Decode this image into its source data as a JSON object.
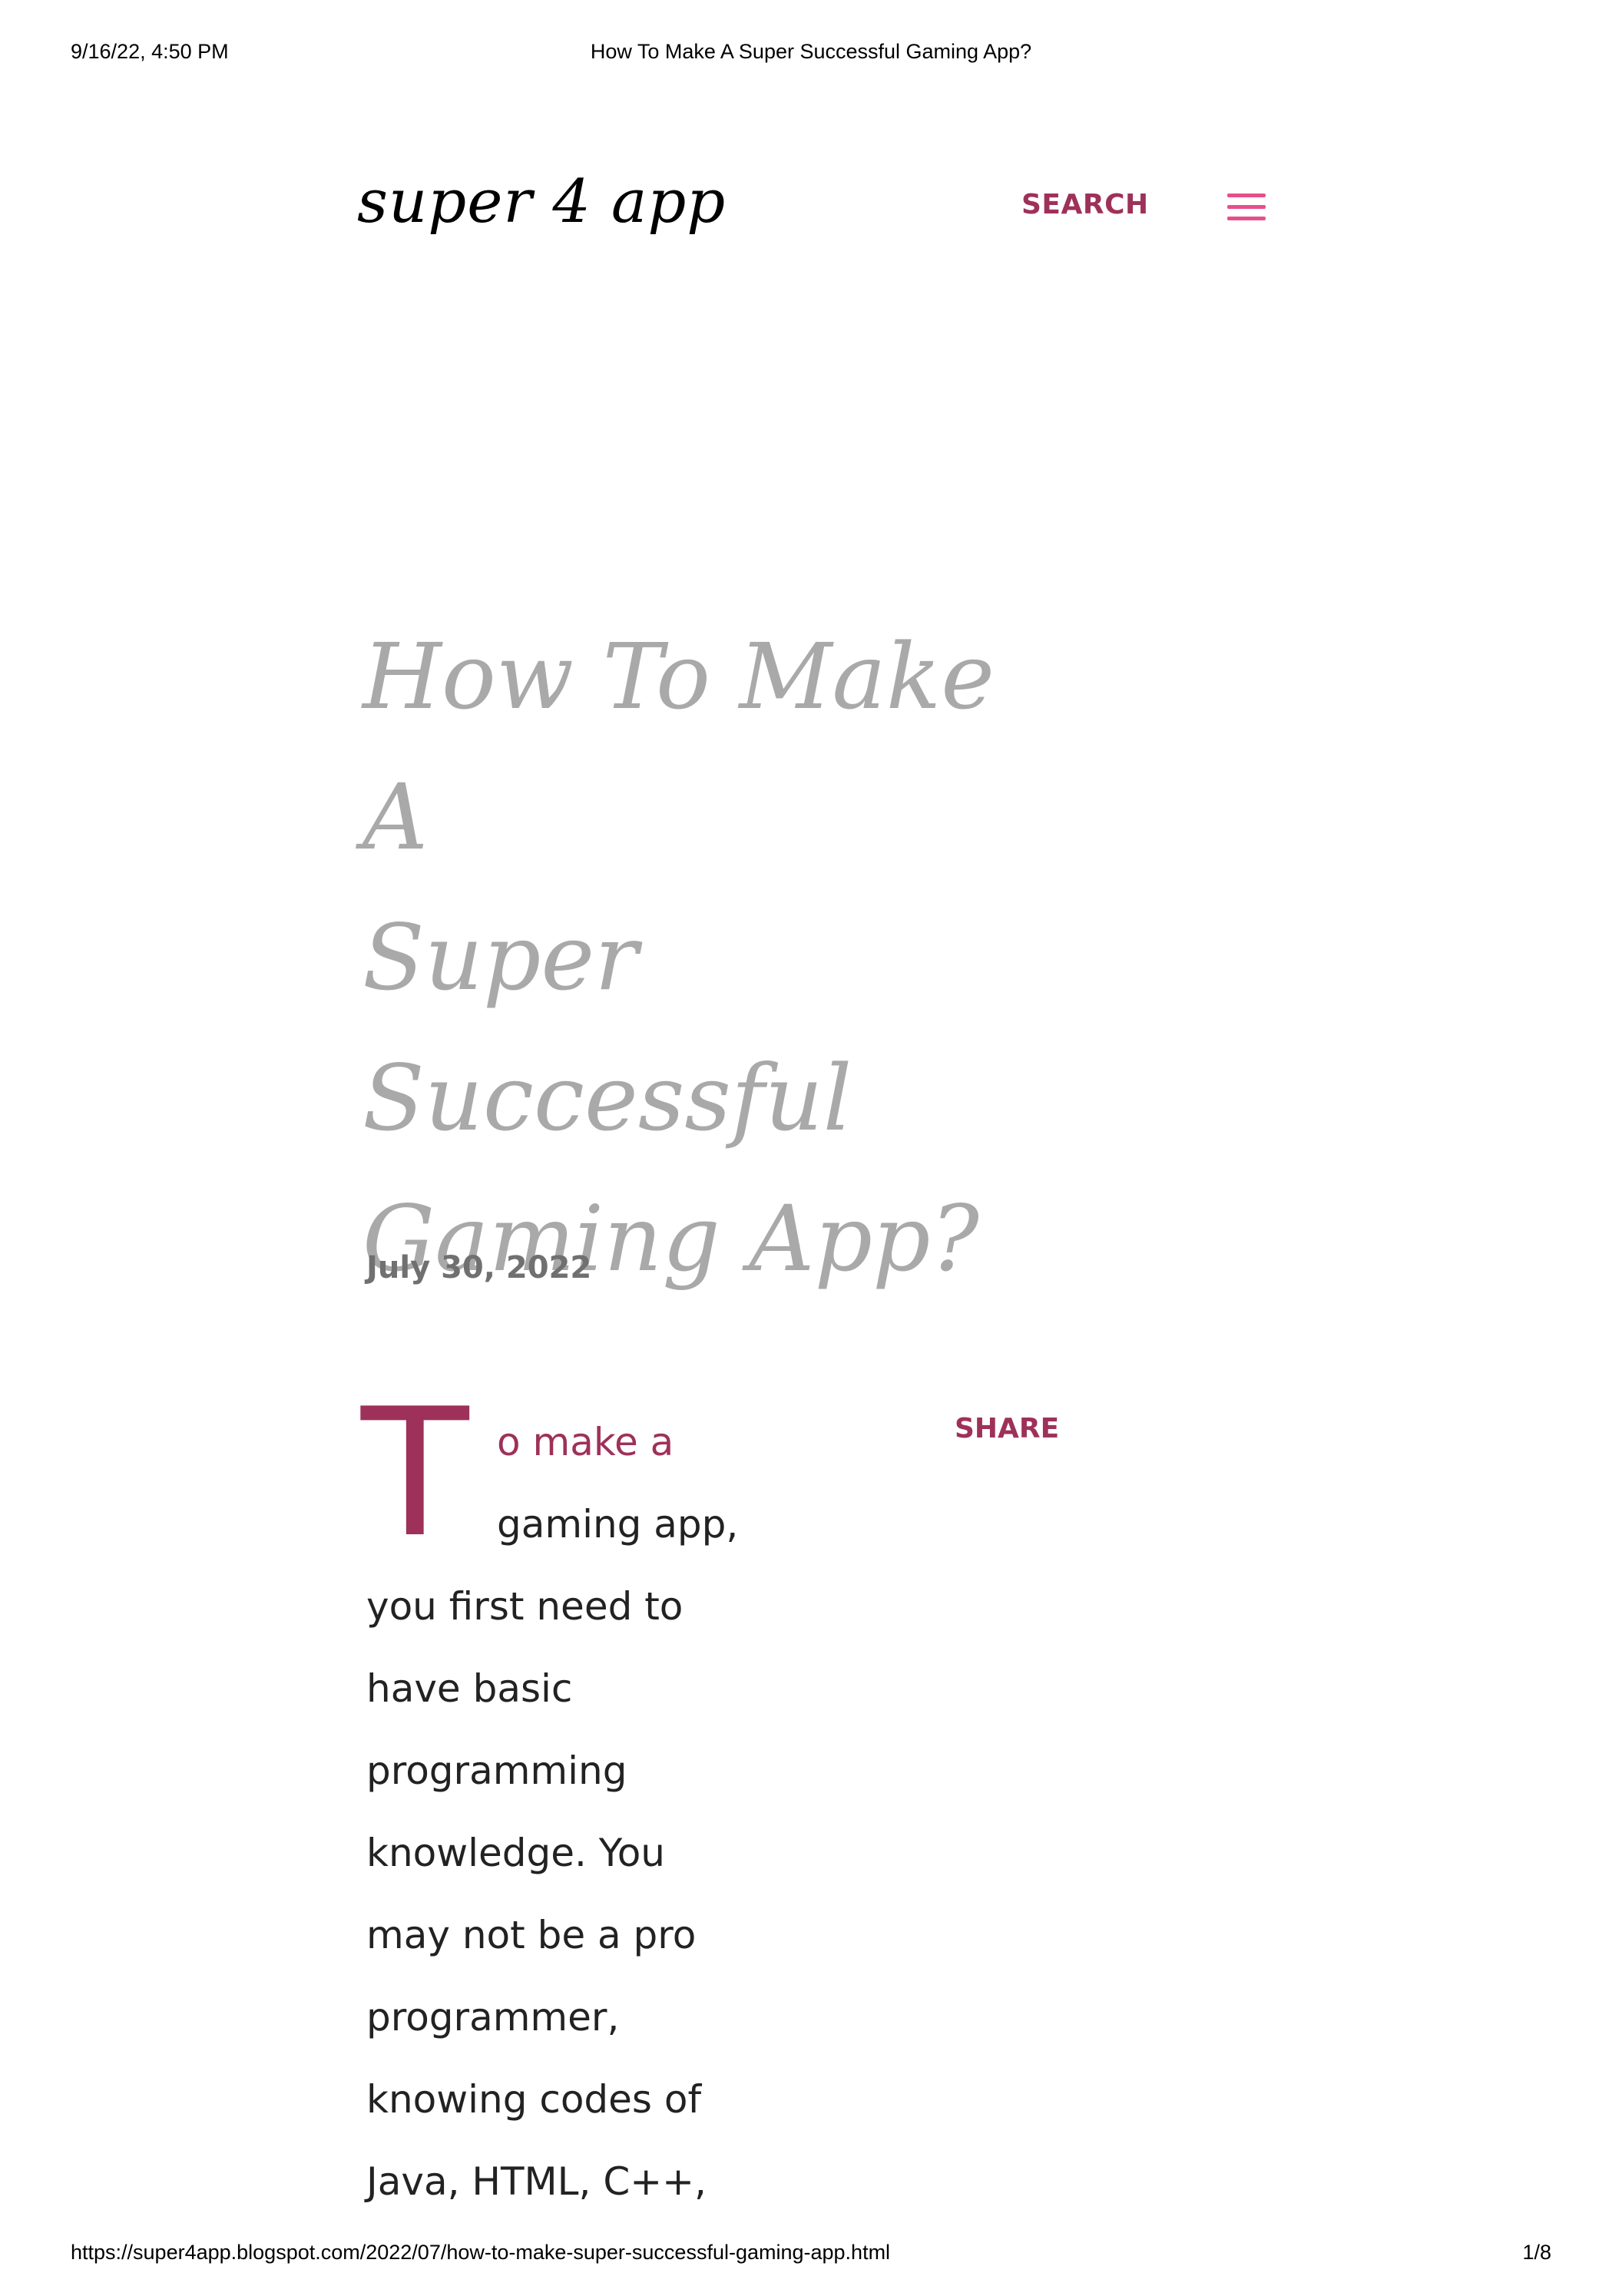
{
  "print_header": {
    "datetime": "9/16/22, 4:50 PM",
    "title": "How To Make A Super Successful Gaming App?"
  },
  "print_footer": {
    "url": "https://super4app.blogspot.com/2022/07/how-to-make-super-successful-gaming-app.html",
    "page": "1/8"
  },
  "header": {
    "logo": "super 4 app",
    "search_label": "SEARCH",
    "menu_icon": "hamburger-menu-icon",
    "accent_color": "#9e3159",
    "menu_color": "#e5508a"
  },
  "post": {
    "title_lines": [
      "How To Make A",
      "Super Successful",
      "Gaming App?"
    ],
    "date": "July 30, 2022",
    "share_label": "SHARE",
    "drop_cap": "T",
    "first_line_link": "o make a",
    "body_lines": [
      "gaming app,",
      "you first need to",
      "have basic",
      "programming",
      "knowledge. You",
      "may not be a pro",
      "programmer,",
      "knowing codes of",
      "Java, HTML, C++,"
    ]
  }
}
